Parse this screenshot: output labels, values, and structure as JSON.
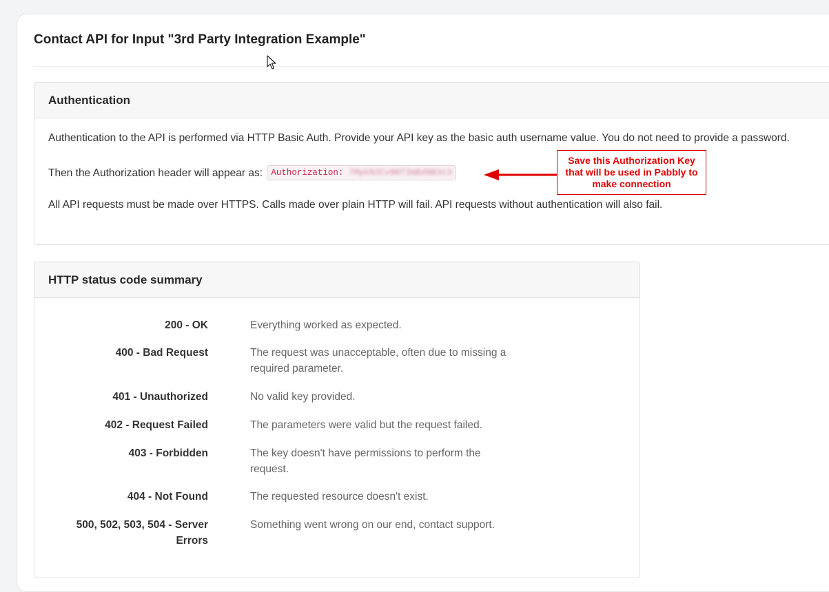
{
  "page": {
    "title": "Contact API for Input \"3rd Party Integration Example\""
  },
  "auth": {
    "header": "Authentication",
    "p1": "Authentication to the API is performed via HTTP Basic Auth. Provide your API key as the basic auth username value. You do not need to provide a password.",
    "p2_prefix": "Then the Authorization header will appear as:",
    "code_label": "Authorization: ",
    "code_key": "7MpkN3CvNNT3mB4NB3c3",
    "p3": "All API requests must be made over HTTPS. Calls made over plain HTTP will fail. API requests without authentication will also fail."
  },
  "annotation": {
    "line1": "Save this Authorization Key",
    "line2": "that will be used in Pabbly to",
    "line3": "make connection",
    "color": "#e00000"
  },
  "status": {
    "header": "HTTP status code summary",
    "rows": [
      {
        "code": "200 - OK",
        "desc": "Everything worked as expected."
      },
      {
        "code": "400 - Bad Request",
        "desc": "The request was unacceptable, often due to missing a required parameter."
      },
      {
        "code": "401 - Unauthorized",
        "desc": "No valid key provided."
      },
      {
        "code": "402 - Request Failed",
        "desc": "The parameters were valid but the request failed."
      },
      {
        "code": "403 - Forbidden",
        "desc": "The key doesn't have permissions to perform the request."
      },
      {
        "code": "404 - Not Found",
        "desc": "The requested resource doesn't exist."
      },
      {
        "code": "500, 502, 503, 504 - Server Errors",
        "desc": "Something went wrong on our end, contact support."
      }
    ]
  },
  "colors": {
    "code_text": "#c7254e",
    "annotation_red": "#e00000"
  }
}
